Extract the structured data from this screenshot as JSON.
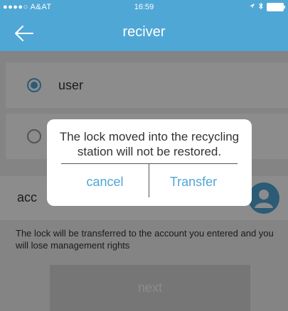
{
  "status_bar": {
    "carrier": "●●●●○ A&AT",
    "time": "16:59"
  },
  "nav": {
    "title": "reciver"
  },
  "options": [
    {
      "label": "user",
      "selected": true
    },
    {
      "label": "",
      "selected": false
    }
  ],
  "account": {
    "label": "acc"
  },
  "notice": "The lock will be transferred to the account you entered and you will lose management rights",
  "next_label": "next",
  "dialog": {
    "message": "The lock moved into the recycling station will not be restored.",
    "cancel_label": "cancel",
    "transfer_label": "Transfer"
  },
  "colors": {
    "accent": "#4fa7d6"
  }
}
